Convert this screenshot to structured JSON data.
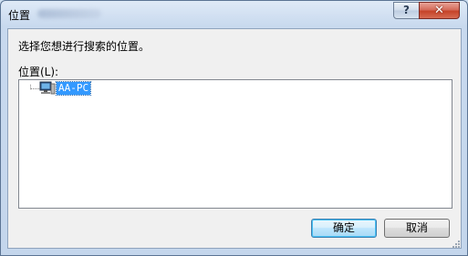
{
  "window": {
    "title": "位置",
    "help_label": "?",
    "close_label": "✕"
  },
  "dialog": {
    "prompt": "选择您想进行搜索的位置。",
    "location_label": "位置(L):"
  },
  "tree": {
    "items": [
      {
        "label": "AA-PC",
        "icon": "computer-icon",
        "selected": true
      }
    ]
  },
  "buttons": {
    "ok_label": "确定",
    "cancel_label": "取消"
  }
}
